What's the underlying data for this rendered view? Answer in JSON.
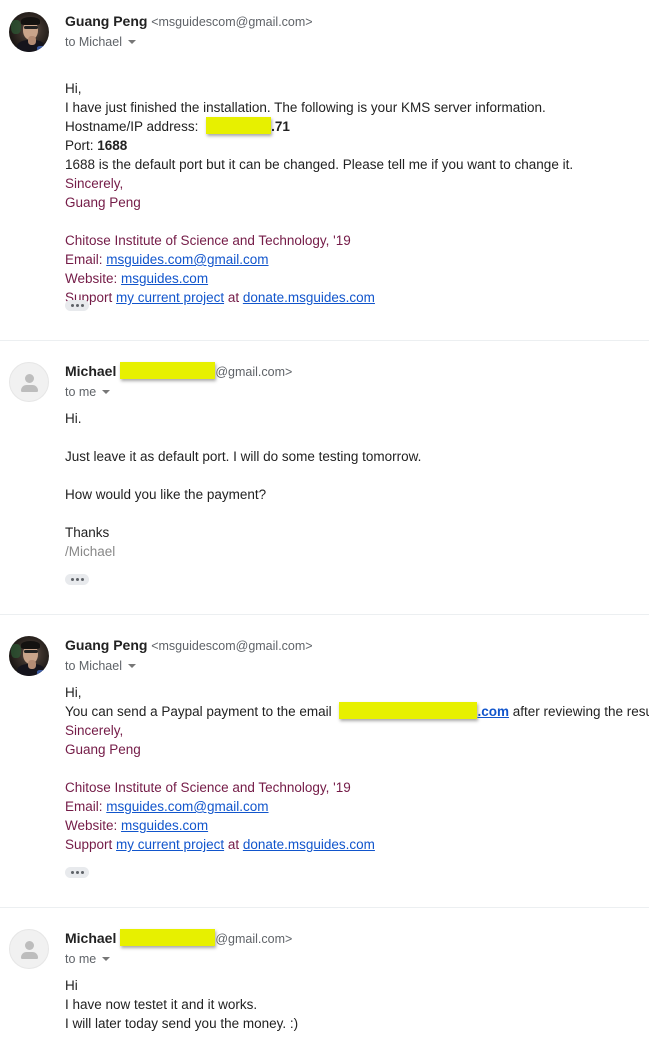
{
  "thread": {
    "messages": [
      {
        "sender_name": "Guang Peng",
        "sender_email": "<msguidescom@gmail.com>",
        "recipient": "to Michael",
        "avatar": "photo-avatar",
        "greeting": "Hi,",
        "line1": "I have just finished the installation. The following is your KMS server information.",
        "ip_label": "Hostname/IP address: ",
        "ip_suffix": ".71",
        "port_label": "Port: ",
        "port_value": "1688",
        "line4": "1688 is the default port but it can be changed. Please tell me if you want to change it.",
        "closing": "Sincerely,",
        "sign_name": "Guang Peng",
        "signature": {
          "institute": "Chitose Institute of Science and Technology, '19",
          "email_label": "Email: ",
          "email_link": "msguides.com@gmail.com",
          "website_label": "Website: ",
          "website_link": "msguides.com",
          "support_label": "Support ",
          "support_link": "my current project",
          "support_at": " at ",
          "donate_link": "donate.msguides.com"
        },
        "show_trimmed_icon": "ellipsis-icon"
      },
      {
        "sender_name": "Michael",
        "sender_email_suffix": "@gmail.com>",
        "recipient": "to me",
        "avatar": "generic-person-avatar",
        "line1": "Hi.",
        "line2": "Just leave it as default port. I will do some testing tomorrow.",
        "line3": "How would you like the payment?",
        "line4": "Thanks",
        "line5": "/Michael",
        "show_trimmed_icon": "ellipsis-icon"
      },
      {
        "sender_name": "Guang Peng",
        "sender_email": "<msguidescom@gmail.com>",
        "recipient": "to Michael",
        "avatar": "photo-avatar",
        "greeting": "Hi,",
        "paypal_prefix": "You can send a Paypal payment to the email ",
        "paypal_link_suffix": ".com",
        "paypal_after": " after reviewing the result.",
        "closing": "Sincerely,",
        "sign_name": "Guang Peng",
        "signature": {
          "institute": "Chitose Institute of Science and Technology, '19",
          "email_label": "Email: ",
          "email_link": "msguides.com@gmail.com",
          "website_label": "Website: ",
          "website_link": "msguides.com",
          "support_label": "Support ",
          "support_link": "my current project",
          "support_at": " at ",
          "donate_link": "donate.msguides.com"
        },
        "show_trimmed_icon": "ellipsis-icon"
      },
      {
        "sender_name": "Michael",
        "sender_email_suffix": "@gmail.com>",
        "recipient": "to me",
        "avatar": "generic-person-avatar",
        "line1": "Hi",
        "line2": "I have now testet it and it works.",
        "line3": "I will later today send you the money. :)"
      }
    ]
  },
  "colors": {
    "signature": "#741b47",
    "link": "#1155cc",
    "redaction": "#e7f000",
    "divider": "#eceff1"
  }
}
